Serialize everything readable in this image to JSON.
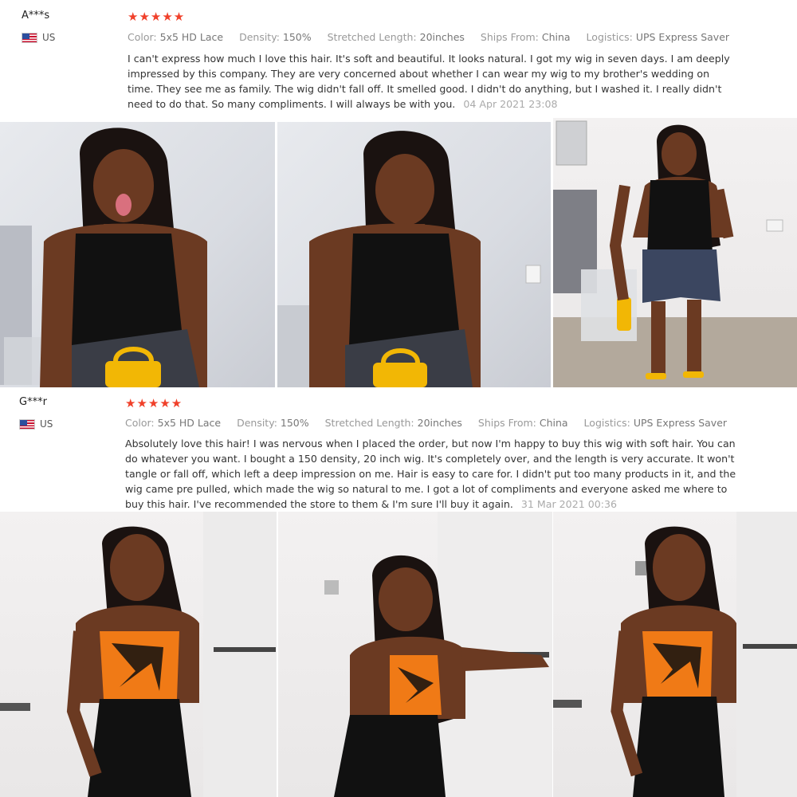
{
  "reviews": [
    {
      "user": "A***s",
      "country": "US",
      "rating": "★★★★★",
      "meta": {
        "color_label": "Color:",
        "color": "5x5 HD Lace",
        "density_label": "Density:",
        "density": "150%",
        "length_label": "Stretched Length:",
        "length": "20inches",
        "ships_label": "Ships From:",
        "ships": "China",
        "logistics_label": "Logistics:",
        "logistics": "UPS Express Saver"
      },
      "text": "I can't express how much I love this hair. It's soft and beautiful. It looks natural. I got my wig in seven days. I am deeply impressed by this company. They are very concerned about whether I can wear my wig to my brother's wedding on time. They see me as family. The wig didn't fall off. It smelled good. I didn't do anything, but I washed it. I really didn't need to do that. So many compliments. I will always be with you.",
      "date": "04 Apr 2021 23:08"
    },
    {
      "user": "G***r",
      "country": "US",
      "rating": "★★★★★",
      "meta": {
        "color_label": "Color:",
        "color": "5x5 HD Lace",
        "density_label": "Density:",
        "density": "150%",
        "length_label": "Stretched Length:",
        "length": "20inches",
        "ships_label": "Ships From:",
        "ships": "China",
        "logistics_label": "Logistics:",
        "logistics": "UPS Express Saver"
      },
      "text": "Absolutely love this hair! I was nervous when I placed the order, but now I'm happy to buy this wig with soft hair. You can do whatever you want. I bought a 150 density, 20 inch wig. It's completely over, and the length is very accurate. It won't tangle or fall off, which left a deep impression on me. Hair is easy to care for. I didn't put too many products in it, and the wig came pre pulled, which made the wig so natural to me. I got a lot of compliments and everyone asked me where to buy this hair. I've recommended the store to them & I'm sure I'll buy it again.",
      "date": "31 Mar 2021 00:36"
    }
  ],
  "colors": {
    "star": "#f0402a",
    "top_black": "#111111",
    "bag_yellow": "#f2b705",
    "denim": "#3b4660",
    "orange_top": "#f07a16",
    "skin": "#6b3a22",
    "hair": "#1a1210"
  }
}
